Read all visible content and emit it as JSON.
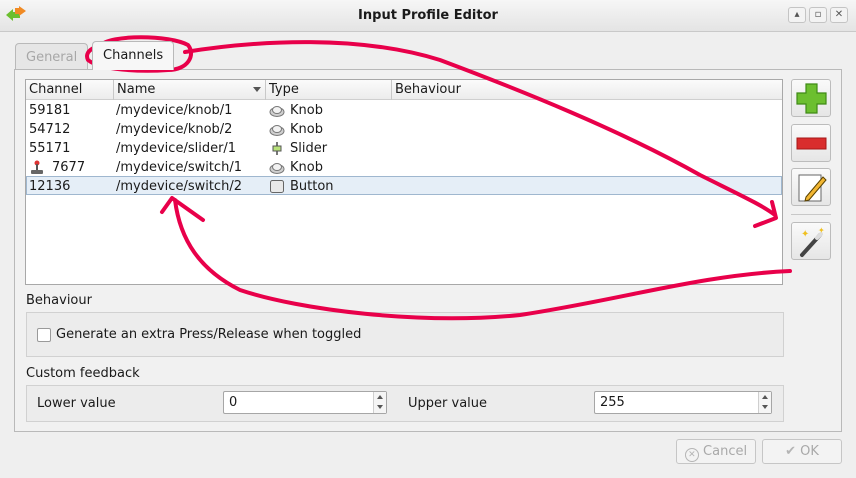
{
  "window": {
    "title": "Input Profile Editor",
    "controls": [
      "restore-icon",
      "maximize-icon",
      "close-icon"
    ]
  },
  "tabs": [
    {
      "label": "General",
      "active": false
    },
    {
      "label": "Channels",
      "active": true
    }
  ],
  "table": {
    "columns": [
      "Channel",
      "Name",
      "Type",
      "Behaviour"
    ],
    "rows": [
      {
        "channel": "59181",
        "name": "/mydevice/knob/1",
        "type": "Knob",
        "type_icon": "knob-icon"
      },
      {
        "channel": "54712",
        "name": "/mydevice/knob/2",
        "type": "Knob",
        "type_icon": "knob-icon"
      },
      {
        "channel": "55171",
        "name": "/mydevice/slider/1",
        "type": "Slider",
        "type_icon": "slider-icon"
      },
      {
        "channel": "7677",
        "name": "/mydevice/switch/1",
        "type": "Knob",
        "type_icon": "knob-icon",
        "row_icon": "joystick-icon"
      },
      {
        "channel": "12136",
        "name": "/mydevice/switch/2",
        "type": "Button",
        "type_icon": "button-icon",
        "selected": true
      }
    ]
  },
  "side_buttons": [
    "add-icon",
    "remove-icon",
    "edit-icon",
    "wizard-icon"
  ],
  "behaviour": {
    "heading": "Behaviour",
    "checkbox_label": "Generate an extra Press/Release when toggled",
    "checked": false
  },
  "feedback": {
    "heading": "Custom feedback",
    "lower_label": "Lower value",
    "lower_value": "0",
    "upper_label": "Upper value",
    "upper_value": "255"
  },
  "footer": {
    "cancel_label": "Cancel",
    "ok_label": "OK"
  },
  "colors": {
    "annotation": "#e8004a",
    "selection": "#e5eef7",
    "add": "#6cbf2f",
    "remove": "#d92d2d"
  }
}
